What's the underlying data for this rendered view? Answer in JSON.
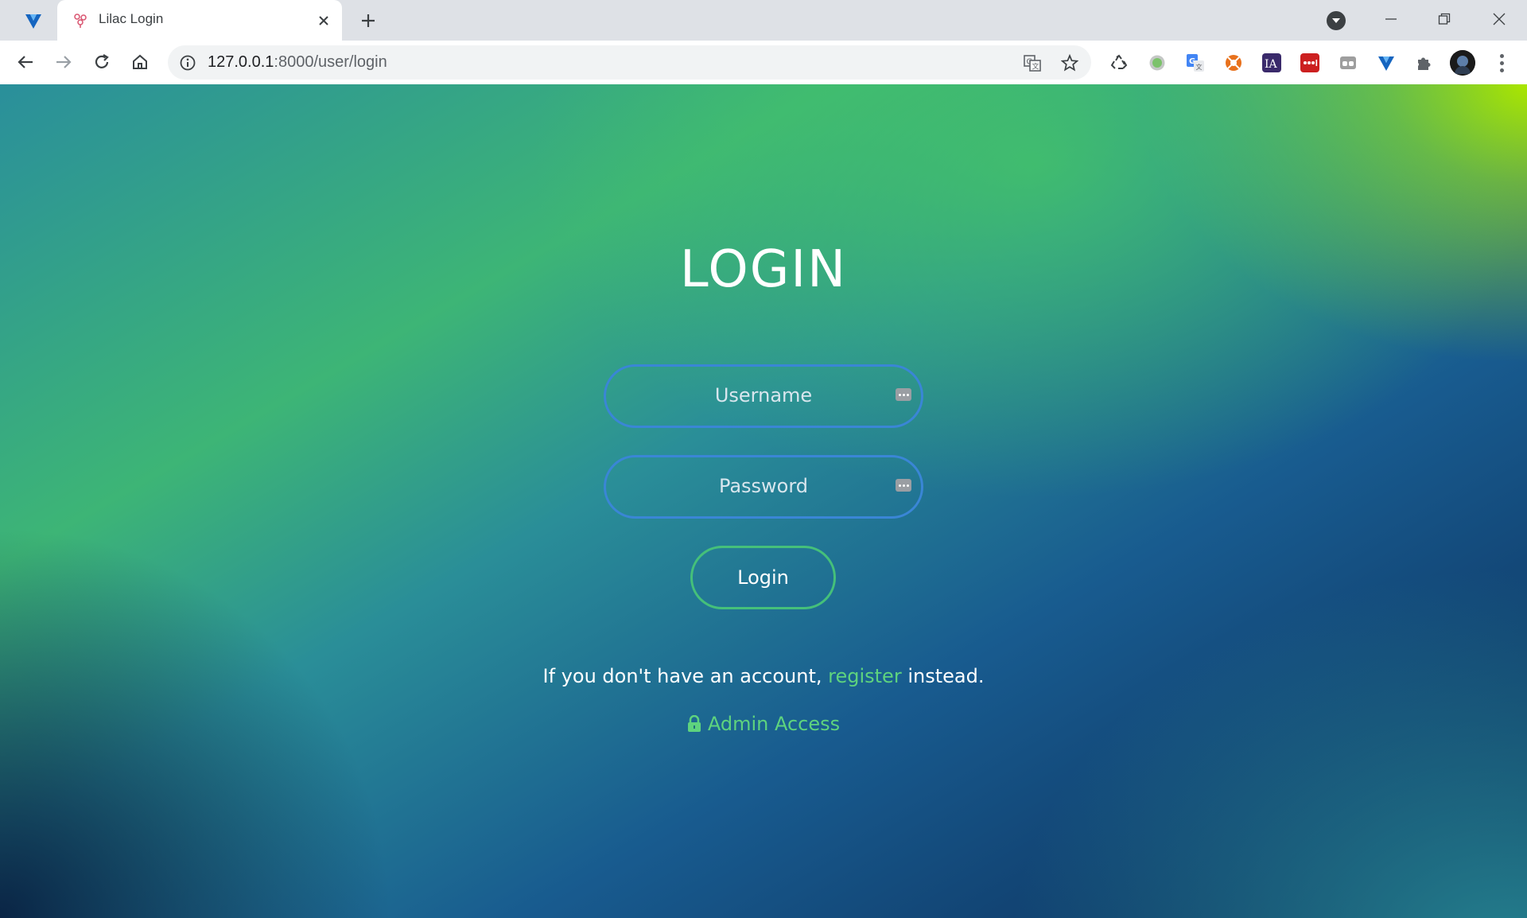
{
  "browser": {
    "tab": {
      "title": "Lilac Login"
    },
    "url_host": "127.0.0.1",
    "url_path": ":8000/user/login"
  },
  "page": {
    "heading": "LOGIN",
    "username_placeholder": "Username",
    "password_placeholder": "Password",
    "login_button": "Login",
    "register_prefix": "If you don't have an account, ",
    "register_link": "register",
    "register_suffix": " instead.",
    "admin_link": "Admin Access"
  },
  "colors": {
    "field_border": "#3a86d6",
    "button_border": "#45c07a",
    "link": "#5ed37e"
  },
  "icons": {
    "pinned_tab": "vivaldi-like-v-icon",
    "tab_favicon": "lilac-flower-icon",
    "extensions": [
      "recycle-icon",
      "green-circle-icon",
      "google-translate-icon",
      "orange-lifebuoy-icon",
      "ia-icon",
      "lastpass-icon",
      "incognito-icon",
      "v-icon",
      "puzzle-icon"
    ]
  }
}
